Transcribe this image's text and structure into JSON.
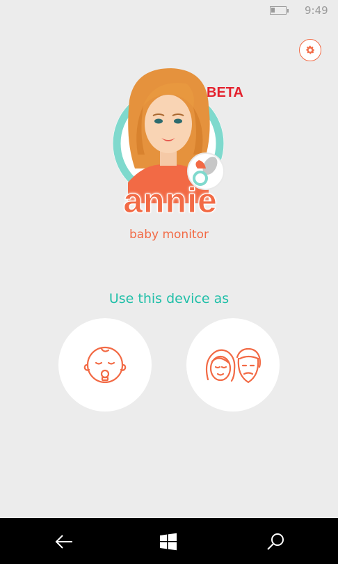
{
  "status": {
    "time": "9:49",
    "battery_icon": "battery-icon"
  },
  "settings": {
    "icon": "gear-icon"
  },
  "logo": {
    "wordmark": "annie",
    "badge": "BETA",
    "subtitle": "baby monitor"
  },
  "prompt": "Use this device as",
  "roles": [
    {
      "icon": "baby-face-icon"
    },
    {
      "icon": "parents-faces-icon"
    }
  ],
  "nav": {
    "back_icon": "back-arrow-icon",
    "home_icon": "windows-icon",
    "search_icon": "search-icon"
  },
  "colors": {
    "accent": "#f26a45",
    "teal": "#1fbfa8",
    "beta_red": "#e4222e",
    "background": "#ececec"
  }
}
